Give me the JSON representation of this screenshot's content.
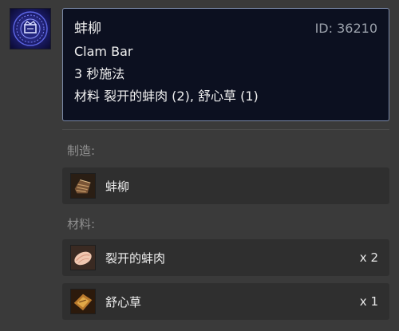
{
  "recipe": {
    "icon": "blue-recipe-seal-icon",
    "name_zh": "蚌柳",
    "id_text": "ID: 36210",
    "name_en": "Clam Bar",
    "cast_time": "3 秒施法",
    "materials_line": "材料 裂开的蚌肉 (2), 舒心草 (1)"
  },
  "crafts_section": {
    "label": "制造:",
    "items": [
      {
        "name": "蚌柳",
        "icon": "clam-bar-item-icon"
      }
    ]
  },
  "materials_section": {
    "label": "材料:",
    "items": [
      {
        "name": "裂开的蚌肉",
        "qty": "x 2",
        "icon": "cracked-clam-meat-icon"
      },
      {
        "name": "舒心草",
        "qty": "x 1",
        "icon": "soothing-herb-icon"
      }
    ]
  },
  "colors": {
    "background": "#3a3a3a",
    "tooltip_bg": "#0c1020",
    "tooltip_border": "#7c8aa8",
    "card_bg": "#2f2f2f",
    "section_label": "#8f8f8f"
  }
}
